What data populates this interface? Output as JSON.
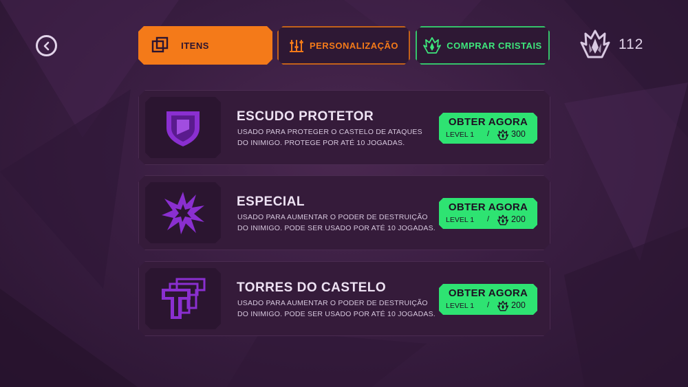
{
  "header": {
    "tabs": [
      {
        "label": "ITENS",
        "active": true
      },
      {
        "label": "PERSONALIZAÇÃO",
        "active": false
      },
      {
        "label": "COMPRAR CRISTAIS",
        "active": false
      }
    ],
    "crystal_balance": "112"
  },
  "items": [
    {
      "title": "ESCUDO PROTETOR",
      "desc_line1": "USADO PARA PROTEGER O CASTELO DE ATAQUES",
      "desc_line2": "DO INIMIGO. PROTEGE POR ATÉ 10 JOGADAS.",
      "button_label": "OBTER AGORA",
      "level": "LEVEL 1",
      "separator": "/",
      "price": "300",
      "icon": "shield-icon"
    },
    {
      "title": "ESPECIAL",
      "desc_line1": "USADO PARA AUMENTAR O PODER DE DESTRUIÇÃO",
      "desc_line2": "DO INIMIGO. PODE SER USADO POR ATÉ 10 JOGADAS.",
      "button_label": "OBTER AGORA",
      "level": "LEVEL 1",
      "separator": "/",
      "price": "200",
      "icon": "explosion-icon"
    },
    {
      "title": "TORRES DO CASTELO",
      "desc_line1": "USADO PARA AUMENTAR O PODER DE DESTRUIÇÃO",
      "desc_line2": "DO INIMIGO. PODE SER USADO POR ATÉ 10 JOGADAS.",
      "button_label": "OBTER AGORA",
      "level": "LEVEL 1",
      "separator": "/",
      "price": "200",
      "icon": "towers-icon"
    }
  ],
  "colors": {
    "accent_orange": "#f47a19",
    "accent_green": "#2ee372",
    "item_purple": "#8a2fd0",
    "background": "#3a1e42"
  }
}
